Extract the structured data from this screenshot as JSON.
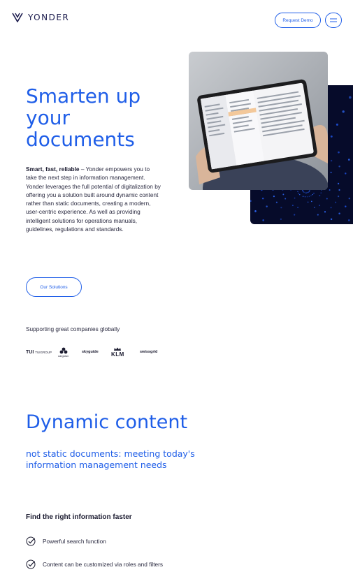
{
  "header": {
    "brand": "YONDER",
    "request_demo_label": "Request Demo",
    "menu_icon": "hamburger-icon"
  },
  "hero": {
    "title": "Smarten up your documents",
    "lead_bold": "Smart, fast, reliable",
    "lead_text": " – Yonder empowers you to take the next step in information management. Yonder leverages the full potential of digitalization by offering you a solution built around dynamic content rather than static documents, creating a modern, user-centric experience. As well as providing intelligent solutions for operations manuals, guidelines, regulations and standards.",
    "cta_label": "Our Solutions"
  },
  "clients": {
    "heading": "Supporting great companies globally",
    "logos": [
      {
        "mark": "TUI",
        "name": "TUIGROUP"
      },
      {
        "name": "cargolux"
      },
      {
        "name": "skyguide"
      },
      {
        "name": "KLM"
      },
      {
        "name": "swissgrid"
      }
    ]
  },
  "dynamic": {
    "title": "Dynamic content",
    "subtitle": "not static documents: meeting today's information management needs"
  },
  "features": {
    "heading": "Find the right information faster",
    "items": [
      {
        "label": "Powerful search function",
        "icon": "check-circle-icon"
      },
      {
        "label": "Content can be customized via roles and filters",
        "icon": "check-circle-icon"
      }
    ]
  },
  "colors": {
    "accent": "#1f5ee8",
    "text_dark": "#1b1b30",
    "dark_panel": "#060b2a"
  }
}
